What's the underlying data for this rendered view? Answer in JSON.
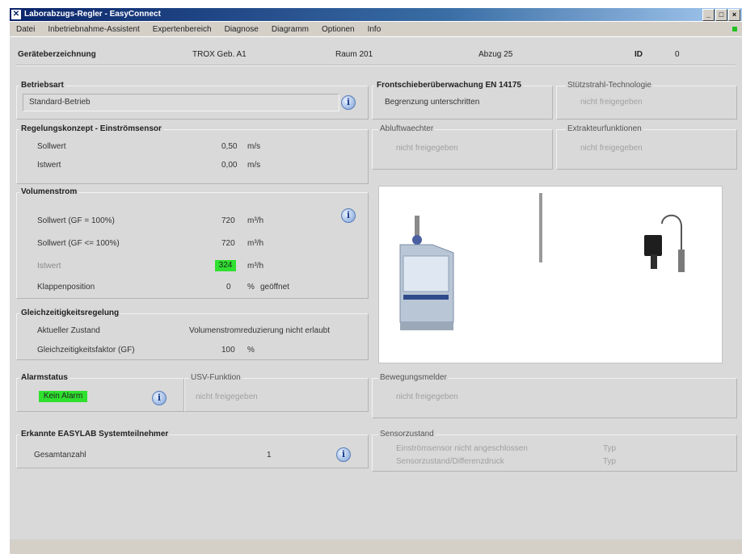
{
  "window": {
    "title": "Laborabzugs-Regler - EasyConnect",
    "buttons": [
      "_",
      "□",
      "×"
    ]
  },
  "menu": [
    "Datei",
    "Inbetriebnahme-Assistent",
    "Expertenbereich",
    "Diagnose",
    "Diagramm",
    "Optionen",
    "Info"
  ],
  "header": {
    "label": "Geräteberzeichnung",
    "device": "TROX Geb. A1",
    "room": "Raum 201",
    "hood": "Abzug 25",
    "id_label": "ID",
    "id_value": "0"
  },
  "betriebsart": {
    "title": "Betriebsart",
    "value": "Standard-Betrieb"
  },
  "frontschieber": {
    "title": "Frontschieberüberwachung EN 14175",
    "value": "Begrenzung unterschritten"
  },
  "stuetzstrahl": {
    "title": "Stützstrahl-Technologie",
    "value": "nicht freigegeben"
  },
  "regelung": {
    "title": "Regelungskonzept - Einströmsensor",
    "rows": [
      {
        "label": "Sollwert",
        "value": "0,50",
        "unit": "m/s"
      },
      {
        "label": "Istwert",
        "value": "0,00",
        "unit": "m/s"
      }
    ]
  },
  "abluft": {
    "title": "Abluftwaechter",
    "value": "nicht freigegeben"
  },
  "extrakteur": {
    "title": "Extrakteurfunktionen",
    "value": "nicht freigegeben"
  },
  "volumenstrom": {
    "title": "Volumenstrom",
    "rows": [
      {
        "label": "Sollwert (GF = 100%)",
        "value": "720",
        "unit": "m³/h",
        "extra": ""
      },
      {
        "label": "Sollwert (GF <= 100%)",
        "value": "720",
        "unit": "m³/h",
        "extra": ""
      },
      {
        "label": "Istwert",
        "value": "324",
        "unit": "m³/h",
        "extra": ""
      },
      {
        "label": "Klappenposition",
        "value": "0",
        "unit": "%",
        "extra": "geöffnet"
      }
    ]
  },
  "gleichzeitigkeit": {
    "title": "Gleichzeitigkeitsregelung",
    "rows": [
      {
        "label": "Aktueller Zustand",
        "value": "Volumenstromreduzierung nicht erlaubt",
        "unit": ""
      },
      {
        "label": "Gleichzeitigkeitsfaktor (GF)",
        "value": "100",
        "unit": "%"
      }
    ]
  },
  "alarmstatus": {
    "title": "Alarmstatus",
    "value": "Kein Alarm"
  },
  "usv": {
    "title": "USV-Funktion",
    "value": "nicht freigegeben"
  },
  "bewegung": {
    "title": "Bewegungsmelder",
    "value": "nicht freigegeben"
  },
  "easylab": {
    "title": "Erkannte EASYLAB Systemteilnehmer",
    "label": "Gesamtanzahl",
    "value": "1"
  },
  "sensorzustand": {
    "title": "Sensorzustand",
    "rows": [
      {
        "label": "Einströmsensor nicht angeschlossen",
        "value": "Typ"
      },
      {
        "label": "Sensorzustand/Differenzdruck",
        "value": "Typ"
      }
    ]
  },
  "colors": {
    "accent_green": "#2fe02f",
    "titlebar": "#0a246a",
    "panel_bg": "#d9d9d9"
  }
}
